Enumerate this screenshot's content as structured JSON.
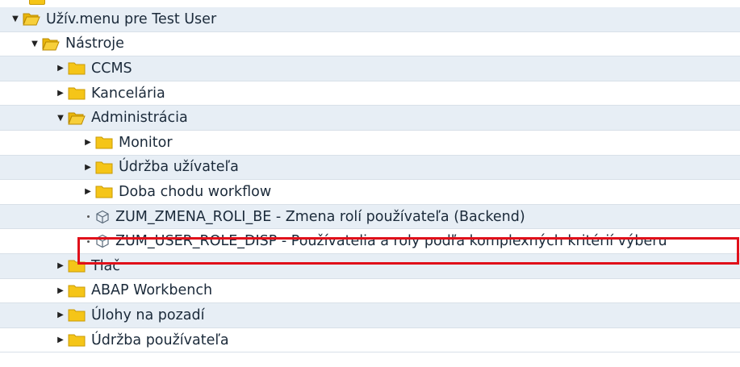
{
  "tree": {
    "root": {
      "label": "Užív.menu pre Test User",
      "expanded": true,
      "icon": "folder-open-icon"
    },
    "nastroje": {
      "label": "Nástroje",
      "expanded": true,
      "icon": "folder-open-icon"
    },
    "ccms": {
      "label": "CCMS",
      "expanded": false,
      "icon": "folder-icon"
    },
    "kancelaria": {
      "label": "Kancelária",
      "expanded": false,
      "icon": "folder-icon"
    },
    "administracia": {
      "label": "Administrácia",
      "expanded": true,
      "icon": "folder-open-icon"
    },
    "monitor": {
      "label": "Monitor",
      "expanded": false,
      "icon": "folder-icon"
    },
    "udrzba_uzivatela": {
      "label": "Údržba užívateľa",
      "expanded": false,
      "icon": "folder-icon"
    },
    "doba_chodu": {
      "label": "Doba chodu workflow",
      "expanded": false,
      "icon": "folder-icon"
    },
    "zmena_roli": {
      "label": "ZUM_ZMENA_ROLI_BE - Zmena rolí používateľa (Backend)",
      "icon": "transaction-cube-icon"
    },
    "user_role_disp": {
      "label": "ZUM_USER_ROLE_DISP - Používatelia a roly podľa komplexných kritérií výberu",
      "icon": "transaction-cube-icon",
      "highlighted": true
    },
    "tlac": {
      "label": "Tlač",
      "expanded": false,
      "icon": "folder-icon"
    },
    "abap": {
      "label": "ABAP Workbench",
      "expanded": false,
      "icon": "folder-icon"
    },
    "ulohy": {
      "label": "Úlohy na pozadí",
      "expanded": false,
      "icon": "folder-icon"
    },
    "udrzba_pouzivatela": {
      "label": "Údržba používateľa",
      "expanded": false,
      "icon": "folder-icon"
    }
  },
  "colors": {
    "folder": "#f5c518",
    "highlight": "#e0101a",
    "row_alt": "#e7eef5"
  }
}
